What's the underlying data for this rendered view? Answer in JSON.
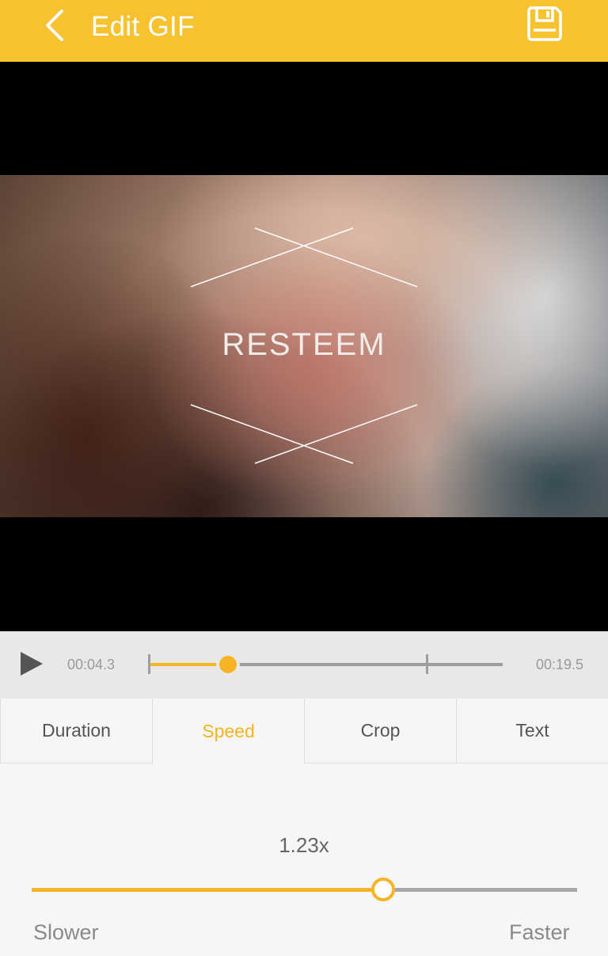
{
  "header": {
    "title": "Edit GIF",
    "back_icon": "chevron-left-icon",
    "save_icon": "floppy-disk-icon",
    "background": "#f7c22f"
  },
  "preview": {
    "overlay_text": "RESTEEM"
  },
  "timeline": {
    "play_icon": "play-icon",
    "current_time": "00:04.3",
    "end_time": "00:19.5",
    "accent": "#f7b425"
  },
  "tabs": [
    {
      "label": "Duration",
      "active": false
    },
    {
      "label": "Speed",
      "active": true
    },
    {
      "label": "Crop",
      "active": false
    },
    {
      "label": "Text",
      "active": false
    }
  ],
  "speed": {
    "value_label": "1.23x",
    "min_label": "Slower",
    "max_label": "Faster",
    "slider_fraction": 0.645
  }
}
